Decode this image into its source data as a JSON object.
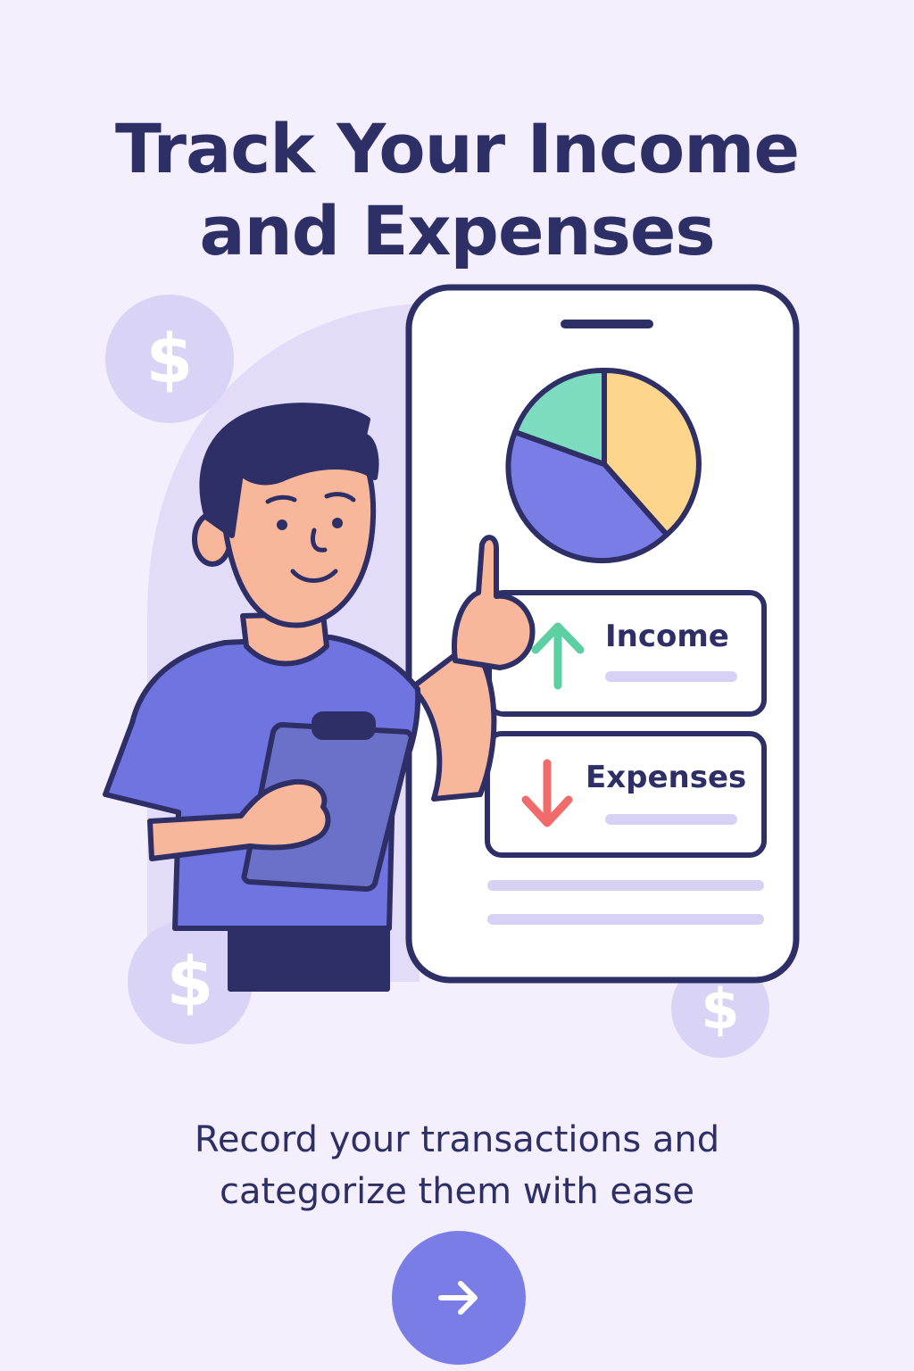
{
  "onboarding": {
    "title_line1": "Track Your Income",
    "title_line2": "and Expenses",
    "subtitle_line1": "Record your transactions and",
    "subtitle_line2": "categorize them with ease"
  },
  "illustration": {
    "income_label": "Income",
    "expenses_label": "Expenses",
    "dollar_symbol": "$"
  },
  "icons": {
    "next": "arrow-right-icon",
    "income": "arrow-up-icon",
    "expenses": "arrow-down-icon",
    "coin": "dollar-icon"
  },
  "colors": {
    "background": "#f3effc",
    "title": "#2e2f66",
    "accent": "#7a7de6",
    "income": "#5cd0a3",
    "expenses": "#f26b6b",
    "pie_yellow": "#fdd58c",
    "pie_teal": "#7ddcc0",
    "pie_blue": "#7a7de6",
    "coin": "#d9d3f5"
  }
}
